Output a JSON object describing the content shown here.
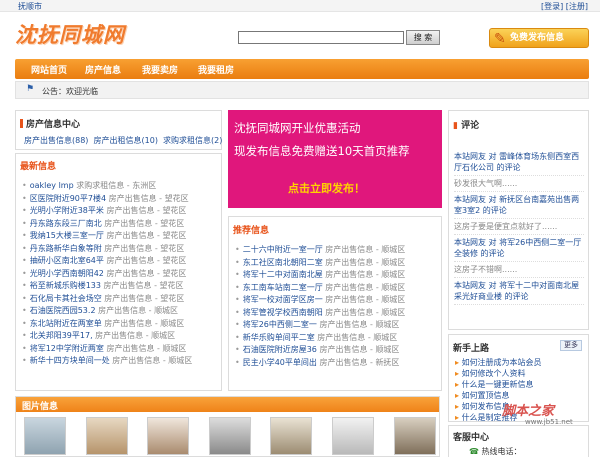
{
  "topbar": {
    "city": "抚顺市",
    "login": "[登录]",
    "register": "[注册]"
  },
  "logo": {
    "text": "沈抚同城网"
  },
  "search": {
    "placeholder": "",
    "button": "搜 索"
  },
  "publish_button": "免费发布信息",
  "nav": {
    "items": [
      "网站首页",
      "房产信息",
      "我要卖房",
      "我要租房"
    ]
  },
  "notice": {
    "label": "公告：",
    "text": "欢迎光临"
  },
  "info_center": {
    "title": "房产信息中心",
    "links": [
      "房产出售信息(88)",
      "房产出租信息(10)",
      "求购求租信息(2)"
    ]
  },
  "latest": {
    "title": "最新信息",
    "items": [
      {
        "title": "oakley lmp",
        "cat": "求购求租信息",
        "area": "东洲区"
      },
      {
        "title": "区医院附近90平7楼4",
        "cat": "房产出售信息",
        "area": "望花区"
      },
      {
        "title": "光明小学附近38平米",
        "cat": "房产出售信息",
        "area": "望花区"
      },
      {
        "title": "丹东路东段三厂南北",
        "cat": "房产出售信息",
        "area": "望花区"
      },
      {
        "title": "我纳15大楼三室一厅",
        "cat": "房产出售信息",
        "area": "望花区"
      },
      {
        "title": "丹东路新华白象等附",
        "cat": "房产出售信息",
        "area": "望花区"
      },
      {
        "title": "抽研小区南北室64平",
        "cat": "房产出售信息",
        "area": "望花区"
      },
      {
        "title": "光明小学西南朝阳42",
        "cat": "房产出售信息",
        "area": "望花区"
      },
      {
        "title": "裕至新城乐购楼133",
        "cat": "房产出售信息",
        "area": "望花区"
      },
      {
        "title": "石化局卡其社会场空",
        "cat": "房产出售信息",
        "area": "望花区"
      },
      {
        "title": "石油医院西园53.2",
        "cat": "房产出售信息",
        "area": "顺城区"
      },
      {
        "title": "东北站附近在两室单",
        "cat": "房产出售信息",
        "area": "顺城区"
      },
      {
        "title": "北关邦阳39平17,",
        "cat": "房产出售信息",
        "area": "顺城区"
      },
      {
        "title": "将军12中学附近两室",
        "cat": "房产出售信息",
        "area": "顺城区"
      },
      {
        "title": "新华十四方块单间一处",
        "cat": "房产出售信息",
        "area": "顺城区"
      }
    ]
  },
  "banner": {
    "line1": "沈抚同城网开业优惠活动",
    "line2": "现发布信息免费赠送10天首页推荐",
    "cta": "点击立即发布！"
  },
  "recommended": {
    "title": "推荐信息",
    "items": [
      {
        "title": "二十六中附近一室一厅",
        "cat": "房产出售信息",
        "area": "顺城区"
      },
      {
        "title": "东工社区南北朝阳二室",
        "cat": "房产出售信息",
        "area": "顺城区"
      },
      {
        "title": "将军十二中对面南北屋",
        "cat": "房产出售信息",
        "area": "顺城区"
      },
      {
        "title": "东工南车站南二室一厅",
        "cat": "房产出售信息",
        "area": "顺城区"
      },
      {
        "title": "将军一校对面学区房一",
        "cat": "房产出售信息",
        "area": "顺城区"
      },
      {
        "title": "将军管视学校西南朝阳",
        "cat": "房产出售信息",
        "area": "顺城区"
      },
      {
        "title": "将军26中西侧二室一",
        "cat": "房产出售信息",
        "area": "顺城区"
      },
      {
        "title": "新华乐购单间平二室",
        "cat": "房产出售信息",
        "area": "顺城区"
      },
      {
        "title": "石油医院附近房屋36",
        "cat": "房产出售信息",
        "area": "顺城区"
      },
      {
        "title": "民主小学40平单间出",
        "cat": "房产出售信息",
        "area": "新抚区"
      }
    ]
  },
  "comments": {
    "title": "评论",
    "items": [
      "本站网友 对 雷峰体育场东侧西室西厅石化公司 的评论",
      "砂发很大气啊......",
      "本站网友 对 新抚区台南嘉苑出售两室3室2 的评论",
      "这房子要是便宜点就好了......",
      "本站网友 对 将军26中西侧二室一厅全装修 的评论",
      "这房子不错啊......",
      "本站网友 对 将军十二中对面南北屋采光好商业楼 的评论"
    ]
  },
  "newbie": {
    "title": "新手上路",
    "more": "更多",
    "items": [
      "如何注册成为本站会员",
      "如何修改个人资料",
      "什么是一键更新信息",
      "如何置顶信息",
      "如何发布信息",
      "什么是制定推荐"
    ]
  },
  "service": {
    "title": "客服中心",
    "hotline": "热线电话："
  },
  "photos": {
    "title": "图片信息"
  },
  "watermark": {
    "text": "脚本之家",
    "url": "www.jb51.net"
  },
  "colors": {
    "accent": "#f08a1e",
    "link": "#1f4e96",
    "banner": "#e0177c"
  }
}
